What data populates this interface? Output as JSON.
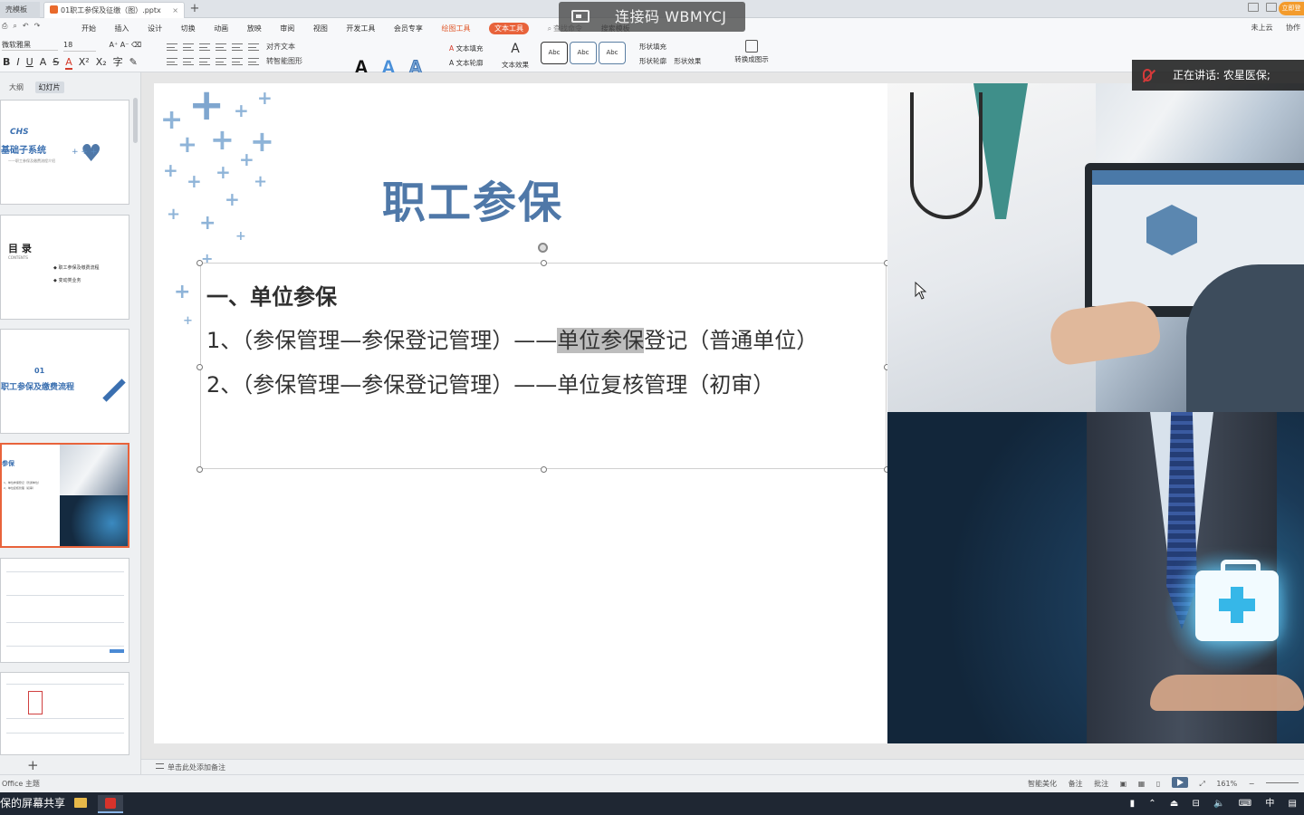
{
  "tabs": {
    "first": "壳模板",
    "doc": "01职工参保及征缴（图）.pptx"
  },
  "overlay": {
    "connect_label": "连接码 WBMYCJ",
    "speaking": "正在讲话: 农星医保;"
  },
  "ribbon": {
    "menu": [
      "开始",
      "插入",
      "设计",
      "切换",
      "动画",
      "放映",
      "审阅",
      "视图",
      "开发工具",
      "会员专享",
      "绘图工具",
      "文本工具",
      "查找命令",
      "搜索模板"
    ],
    "right": [
      "未上云",
      "协作"
    ],
    "font_name": "微软雅黑",
    "font_size": "18",
    "para_cmds": [
      "对齐文本",
      "转智能图形"
    ],
    "text_cmds": [
      "文本填充",
      "文本轮廓",
      "文本效果"
    ],
    "styles": [
      "Abc",
      "Abc",
      "Abc"
    ],
    "shape_cmds": [
      "形状填充",
      "形状轮廓",
      "形状效果"
    ],
    "convert": "转换成图示"
  },
  "left_panel": {
    "tabs": [
      "大纲",
      "幻灯片"
    ],
    "thumbs": [
      {
        "title": "基础子系统",
        "subtitle": "——职工参保及缴费流程介绍"
      },
      {
        "title": "目 录",
        "subtitle": "CONTENTS",
        "items": [
          "职工参保及缴费流程",
          "变动类业务"
        ]
      },
      {
        "number": "01",
        "title": "职工参保及缴费流程"
      },
      {
        "title": "参保",
        "lines": [
          "1、单位参保登记（普通单位）",
          "2、单位复核管理（初审）"
        ]
      }
    ]
  },
  "slide": {
    "title": "职工参保",
    "section": "一、单位参保",
    "item1_pre": "1、（参保管理—参保登记管理）——",
    "item1_hl": "单位参保",
    "item1_post": "登记（普通单位）",
    "item2": "2、（参保管理—参保登记管理）——单位复核管理（初审）"
  },
  "notes_placeholder": "单击此处添加备注",
  "status": {
    "theme": "Office 主题",
    "smart": "智能美化",
    "notes": "备注",
    "comment": "批注",
    "zoom": "161%"
  },
  "taskbar": {
    "share": "保的屏幕共享",
    "ime": "中"
  },
  "colors": {
    "accent": "#e8633b",
    "title_blue": "#4f78a8",
    "cross_blue": "#8fb4d8"
  }
}
